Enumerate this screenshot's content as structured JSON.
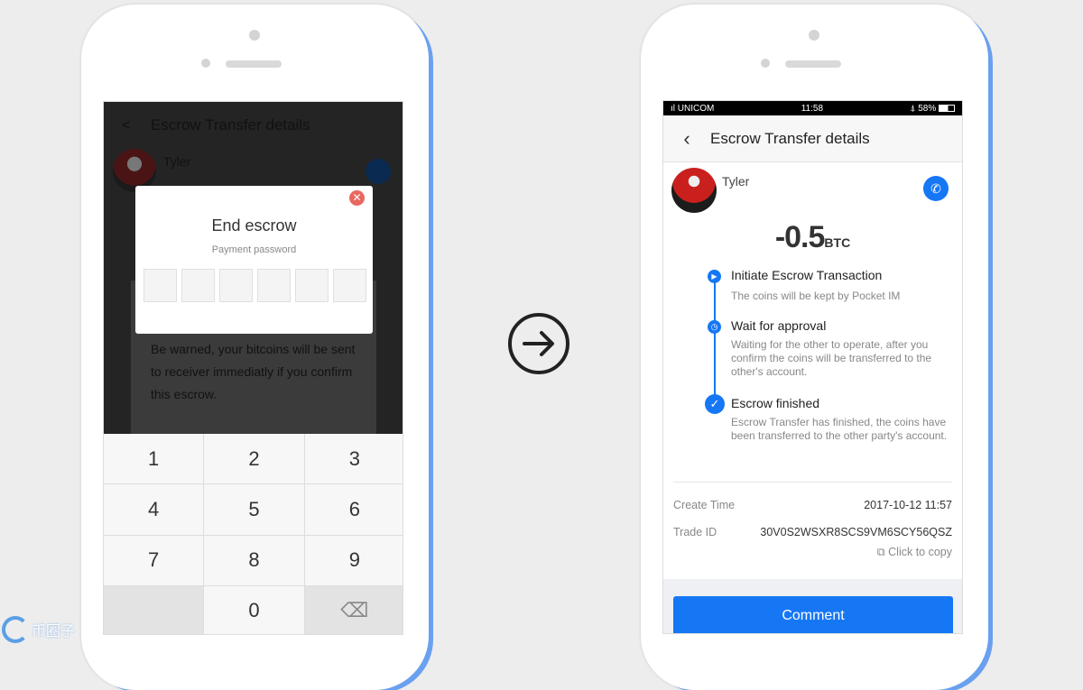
{
  "left_screen": {
    "title": "Escrow Transfer details",
    "user_name": "Tyler",
    "warning": "Be warned, your bitcoins will be sent to receiver immediatly if you confirm this escrow.",
    "dialog": {
      "title": "End escrow",
      "subtitle": "Payment password",
      "pin_length": 6
    },
    "keypad": [
      "1",
      "2",
      "3",
      "4",
      "5",
      "6",
      "7",
      "8",
      "9",
      "",
      "0",
      "⌫"
    ]
  },
  "right_screen": {
    "status_bar": {
      "carrier": "UNICOM",
      "time": "11:58",
      "battery": "58%"
    },
    "title": "Escrow Transfer details",
    "user_name": "Tyler",
    "amount": "-0.5",
    "unit": "BTC",
    "steps": [
      {
        "title": "Initiate Escrow Transaction",
        "desc": "The coins will be kept by Pocket IM"
      },
      {
        "title": "Wait for approval",
        "desc": "Waiting for the other to operate, after you confirm the coins will be transferred to the other's account."
      },
      {
        "title": "Escrow finished",
        "desc": "Escrow Transfer has finished, the coins have been transferred to the other party's account."
      }
    ],
    "create_time_label": "Create Time",
    "create_time": "2017-10-12 11:57",
    "trade_id_label": "Trade ID",
    "trade_id": "30V0S2WSXR8SCS9VM6SCY56QSZ",
    "copy_label": "Click to copy",
    "comment_label": "Comment"
  },
  "colors": {
    "accent": "#1677f5",
    "close": "#e8685f"
  },
  "watermark": "币圈子"
}
